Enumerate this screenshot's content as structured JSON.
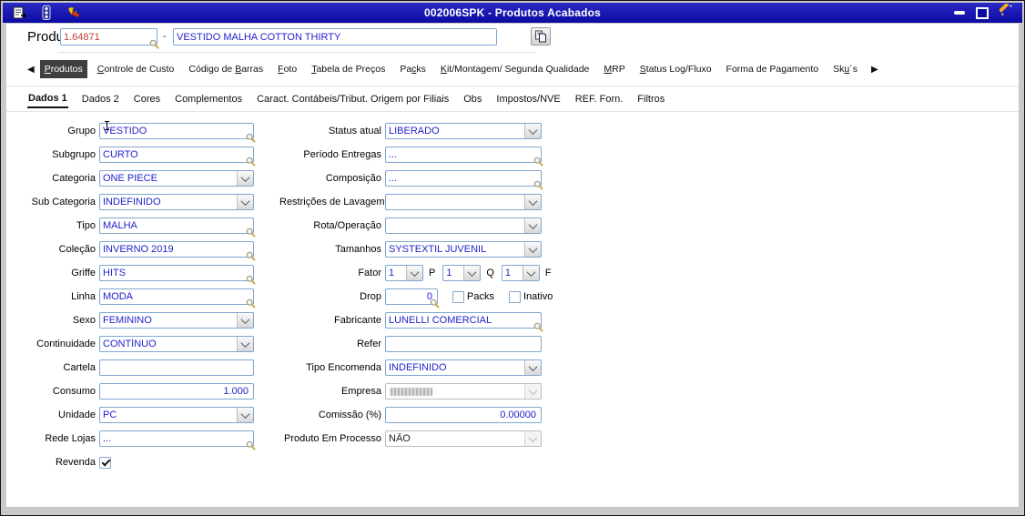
{
  "window": {
    "title": "002006SPK - Produtos Acabados",
    "toolbar_icons": [
      "report-icon",
      "traffic-light-icon",
      "wrench-icon"
    ],
    "controls": [
      "minimize",
      "maximize",
      "edit-pencil"
    ]
  },
  "header": {
    "product_label": "Produto",
    "product_code": "1.64871",
    "separator": "-",
    "product_name": "VESTIDO MALHA COTTON THIRTY"
  },
  "tabs": [
    {
      "label": "Produtos",
      "mnemonic": 0,
      "selected": true
    },
    {
      "label": "Controle de Custo",
      "mnemonic": 0
    },
    {
      "label": "Código de Barras",
      "mnemonic": 10
    },
    {
      "label": "Foto",
      "mnemonic": 0
    },
    {
      "label": "Tabela de Preços",
      "mnemonic": 0
    },
    {
      "label": "Packs",
      "mnemonic": 2
    },
    {
      "label": "Kit/Montagem/ Segunda Qualidade",
      "mnemonic": 0
    },
    {
      "label": "MRP",
      "mnemonic": 0
    },
    {
      "label": "Status Log/Fluxo",
      "mnemonic": 0
    },
    {
      "label": "Forma de Pagamento",
      "mnemonic": 11
    },
    {
      "label": "Sku´s",
      "mnemonic": 2
    }
  ],
  "subtabs": [
    {
      "label": "Dados 1",
      "selected": true
    },
    {
      "label": "Dados 2"
    },
    {
      "label": "Cores"
    },
    {
      "label": "Complementos"
    },
    {
      "label": "Caract. Contábeis/Tribut. Origem por Filiais"
    },
    {
      "label": "Obs"
    },
    {
      "label": "Impostos/NVE"
    },
    {
      "label": "REF. Forn."
    },
    {
      "label": "Filtros"
    }
  ],
  "form": {
    "left": [
      {
        "name": "grupo",
        "label": "Grupo",
        "type": "lookup",
        "value": "VESTIDO"
      },
      {
        "name": "subgrupo",
        "label": "Subgrupo",
        "type": "lookup",
        "value": "CURTO"
      },
      {
        "name": "categoria",
        "label": "Categoria",
        "type": "select",
        "value": "ONE PIECE"
      },
      {
        "name": "sub-categoria",
        "label": "Sub Categoria",
        "type": "select",
        "value": "INDEFINIDO"
      },
      {
        "name": "tipo",
        "label": "Tipo",
        "type": "lookup",
        "value": "MALHA"
      },
      {
        "name": "colecao",
        "label": "Coleção",
        "type": "lookup",
        "value": "INVERNO 2019"
      },
      {
        "name": "griffe",
        "label": "Griffe",
        "type": "lookup",
        "value": "HITS"
      },
      {
        "name": "linha",
        "label": "Linha",
        "type": "lookup",
        "value": "MODA"
      },
      {
        "name": "sexo",
        "label": "Sexo",
        "type": "select",
        "value": "FEMININO"
      },
      {
        "name": "continuidade",
        "label": "Continuidade",
        "type": "select",
        "value": "CONTÍNUO"
      },
      {
        "name": "cartela",
        "label": "Cartela",
        "type": "text",
        "value": ""
      },
      {
        "name": "consumo",
        "label": "Consumo",
        "type": "number",
        "value": "1.000"
      },
      {
        "name": "unidade",
        "label": "Unidade",
        "type": "select",
        "value": "PC"
      },
      {
        "name": "rede-lojas",
        "label": "Rede Lojas",
        "type": "lookup",
        "value": "..."
      },
      {
        "name": "revenda",
        "label": "Revenda",
        "type": "checkbox",
        "checked": true
      }
    ],
    "right": [
      {
        "name": "status-atual",
        "label": "Status atual",
        "type": "select",
        "value": "LIBERADO"
      },
      {
        "name": "periodo-entregas",
        "label": "Período Entregas",
        "type": "lookup",
        "value": "..."
      },
      {
        "name": "composicao",
        "label": "Composição",
        "type": "lookup",
        "value": "..."
      },
      {
        "name": "restricoes-de-lavagem",
        "label": "Restrições de Lavagem",
        "type": "select",
        "value": ""
      },
      {
        "name": "rota-operacao",
        "label": "Rota/Operação",
        "type": "select",
        "value": ""
      },
      {
        "name": "tamanhos",
        "label": "Tamanhos",
        "type": "select",
        "value": "SYSTEXTIL JUVENIL"
      },
      {
        "name": "fator",
        "label": "Fator",
        "type": "fator",
        "selects": [
          "1",
          "1",
          "1"
        ],
        "suffixes": [
          "P",
          "Q",
          "F"
        ]
      },
      {
        "name": "drop",
        "label": "Drop",
        "type": "drop",
        "value": "0",
        "checkboxes": [
          {
            "label": "Packs",
            "checked": false
          },
          {
            "label": "Inativo",
            "checked": false
          }
        ]
      },
      {
        "name": "fabricante",
        "label": "Fabricante",
        "type": "lookup",
        "value": "LUNELLI COMERCIAL"
      },
      {
        "name": "refer",
        "label": "Refer",
        "type": "text",
        "value": ""
      },
      {
        "name": "tipo-encomenda",
        "label": "Tipo Encomenda",
        "type": "select",
        "value": "INDEFINIDO"
      },
      {
        "name": "empresa",
        "label": "Empresa",
        "type": "select-disabled",
        "value": "",
        "obscured": true
      },
      {
        "name": "comissao",
        "label": "Comissão (%)",
        "type": "number",
        "value": "0.00000"
      },
      {
        "name": "produto-em-processo",
        "label": "Produto Em Processo",
        "type": "select-disabled",
        "value": "NÃO"
      }
    ]
  },
  "colors": {
    "titlebar": "#0b0ba2",
    "field_border": "#7ea6cf",
    "value_text": "#2222cc",
    "code_text": "#c43c3c",
    "selected_tab_bg": "#3f3f3f"
  }
}
